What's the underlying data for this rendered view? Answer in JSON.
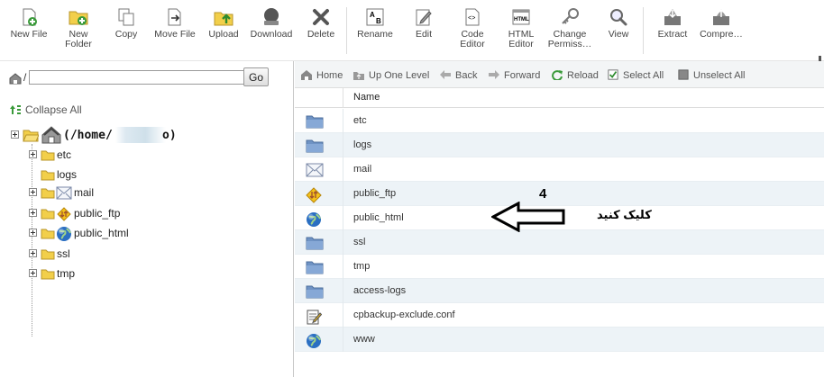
{
  "toolbar": {
    "buttons": [
      {
        "label": "New File",
        "icon": "new-file-icon"
      },
      {
        "label": "New\nFolder",
        "icon": "new-folder-icon"
      },
      {
        "label": "Copy",
        "icon": "copy-icon"
      },
      {
        "label": "Move File",
        "icon": "move-file-icon"
      },
      {
        "label": "Upload",
        "icon": "upload-icon"
      },
      {
        "label": "Download",
        "icon": "download-icon"
      },
      {
        "label": "Delete",
        "icon": "delete-icon"
      },
      {
        "label": "Rename",
        "icon": "rename-icon"
      },
      {
        "label": "Edit",
        "icon": "edit-icon"
      },
      {
        "label": "Code\nEditor",
        "icon": "code-editor-icon"
      },
      {
        "label": "HTML\nEditor",
        "icon": "html-editor-icon"
      },
      {
        "label": "Change\nPermiss…",
        "icon": "change-permissions-icon"
      },
      {
        "label": "View",
        "icon": "view-icon"
      },
      {
        "label": "Extract",
        "icon": "extract-icon"
      },
      {
        "label": "Compre…",
        "icon": "compress-icon"
      }
    ]
  },
  "left": {
    "path_prefix": "/",
    "path_value": "",
    "go_label": "Go",
    "collapse_all": "Collapse All",
    "root_label": "(/home/",
    "root_suffix": "o)",
    "tree": [
      {
        "label": "etc",
        "expandable": true
      },
      {
        "label": "logs",
        "expandable": false
      },
      {
        "label": "mail",
        "expandable": true
      },
      {
        "label": "public_ftp",
        "expandable": true
      },
      {
        "label": "public_html",
        "expandable": true
      },
      {
        "label": "ssl",
        "expandable": true
      },
      {
        "label": "tmp",
        "expandable": true
      }
    ]
  },
  "nav": {
    "home": "Home",
    "up": "Up One Level",
    "back": "Back",
    "forward": "Forward",
    "reload": "Reload",
    "select_all": "Select All",
    "unselect_all": "Unselect All"
  },
  "table": {
    "name_header": "Name",
    "rows": [
      {
        "name": "etc",
        "icon": "folder-icon"
      },
      {
        "name": "logs",
        "icon": "folder-icon"
      },
      {
        "name": "mail",
        "icon": "mail-icon"
      },
      {
        "name": "public_ftp",
        "icon": "ftp-icon"
      },
      {
        "name": "public_html",
        "icon": "globe-icon"
      },
      {
        "name": "ssl",
        "icon": "folder-icon"
      },
      {
        "name": "tmp",
        "icon": "folder-icon"
      },
      {
        "name": "access-logs",
        "icon": "folder-icon"
      },
      {
        "name": "cpbackup-exclude.conf",
        "icon": "document-icon"
      },
      {
        "name": "www",
        "icon": "globe-icon"
      }
    ]
  },
  "annotation": {
    "number": "4",
    "text": "کلیک کنید"
  }
}
